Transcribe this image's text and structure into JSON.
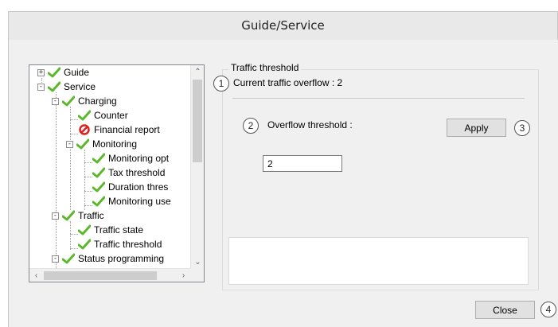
{
  "window": {
    "title": "Guide/Service"
  },
  "tree": {
    "items": [
      {
        "label": "Guide",
        "status": "ok",
        "expander": "+"
      },
      {
        "label": "Service",
        "status": "ok",
        "expander": "-"
      },
      {
        "label": "Charging",
        "status": "ok",
        "expander": "-"
      },
      {
        "label": "Counter",
        "status": "ok"
      },
      {
        "label": "Financial report",
        "status": "blocked"
      },
      {
        "label": "Monitoring",
        "status": "ok",
        "expander": "-"
      },
      {
        "label": "Monitoring opt",
        "status": "ok"
      },
      {
        "label": "Tax threshold",
        "status": "ok"
      },
      {
        "label": "Duration thres",
        "status": "ok"
      },
      {
        "label": "Monitoring use",
        "status": "ok"
      },
      {
        "label": "Traffic",
        "status": "ok",
        "expander": "-"
      },
      {
        "label": "Traffic state",
        "status": "ok"
      },
      {
        "label": "Traffic threshold",
        "status": "ok"
      },
      {
        "label": "Status programming",
        "status": "ok",
        "expander": "-"
      }
    ]
  },
  "panel": {
    "group_title": "Traffic threshold",
    "current_overflow": "Current traffic overflow : 2",
    "threshold_label": "Overflow threshold :",
    "apply_label": "Apply",
    "threshold_value": "2",
    "close_label": "Close"
  },
  "callouts": [
    "1",
    "2",
    "3",
    "4"
  ],
  "colors": {
    "check_green": "#5cb82a",
    "blocked_red": "#e02020"
  }
}
